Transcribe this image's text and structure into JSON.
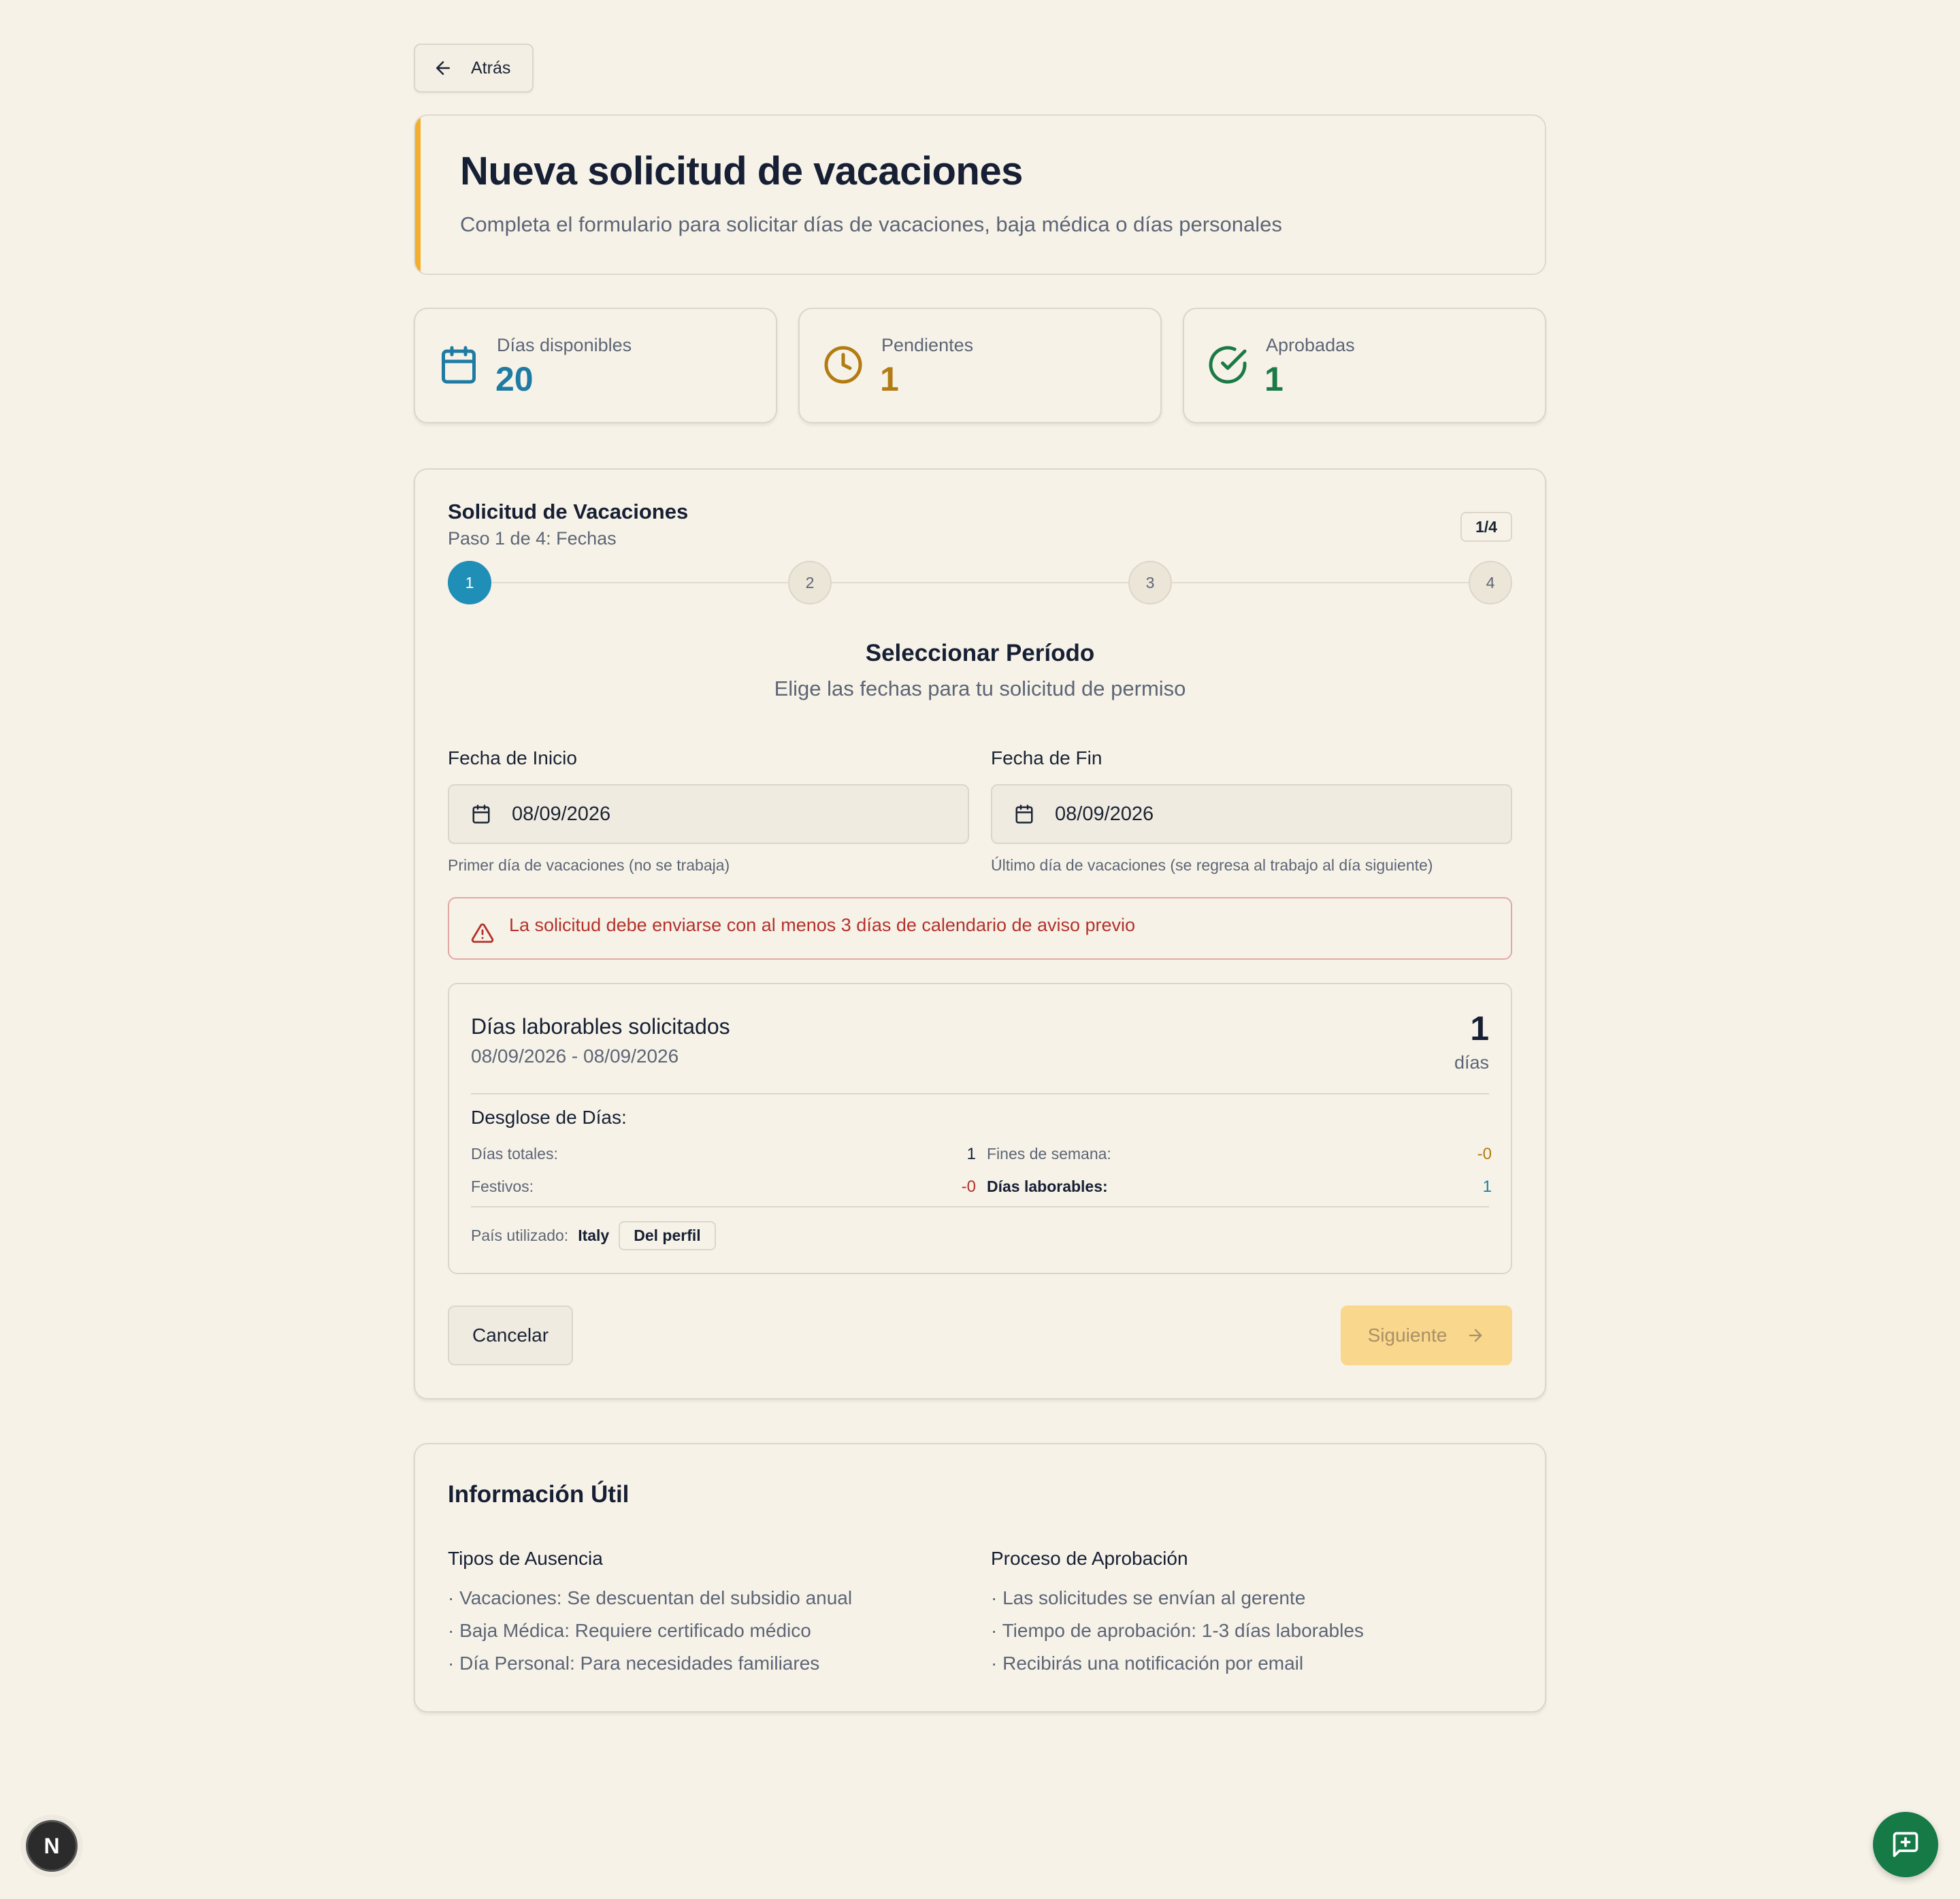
{
  "back": {
    "label": "Atrás"
  },
  "header": {
    "title": "Nueva solicitud de vacaciones",
    "subtitle": "Completa el formulario para solicitar días de vacaciones, baja médica o días personales"
  },
  "stats": [
    {
      "label": "Días disponibles",
      "value": "20",
      "icon": "calendar-icon",
      "color": "#1f7ba3"
    },
    {
      "label": "Pendientes",
      "value": "1",
      "icon": "clock-icon",
      "color": "#b27c12"
    },
    {
      "label": "Aprobadas",
      "value": "1",
      "icon": "check-circle-icon",
      "color": "#1b7a45"
    }
  ],
  "form": {
    "title": "Solicitud de Vacaciones",
    "step_text": "Paso 1 de 4: Fechas",
    "step_badge": "1/4",
    "steps": [
      "1",
      "2",
      "3",
      "4"
    ],
    "active_step": 1,
    "section_title": "Seleccionar Período",
    "section_subtitle": "Elige las fechas para tu solicitud de permiso",
    "start": {
      "label": "Fecha de Inicio",
      "value": "08/09/2026",
      "help": "Primer día de vacaciones (no se trabaja)"
    },
    "end": {
      "label": "Fecha de Fin",
      "value": "08/09/2026",
      "help": "Último día de vacaciones (se regresa al trabajo al día siguiente)"
    },
    "alert": "La solicitud debe enviarse con al menos 3 días de calendario de aviso previo",
    "summary": {
      "title": "Días laborables solicitados",
      "range": "08/09/2026 - 08/09/2026",
      "count": "1",
      "unit": "días",
      "breakdown_title": "Desglose de Días:",
      "total_label": "Días totales:",
      "total_value": "1",
      "weekends_label": "Fines de semana:",
      "weekends_value": "-0",
      "holidays_label": "Festivos:",
      "holidays_value": "-0",
      "workdays_label": "Días laborables:",
      "workdays_value": "1",
      "country_label": "País utilizado:",
      "country_value": "Italy",
      "country_source": "Del perfil"
    },
    "cancel_label": "Cancelar",
    "next_label": "Siguiente"
  },
  "info": {
    "title": "Información Útil",
    "types_title": "Tipos de Ausencia",
    "types": [
      "Vacaciones: Se descuentan del subsidio anual",
      "Baja Médica: Requiere certificado médico",
      "Día Personal: Para necesidades familiares"
    ],
    "process_title": "Proceso de Aprobación",
    "process": [
      "Las solicitudes se envían al gerente",
      "Tiempo de aprobación: 1-3 días laborables",
      "Recibirás una notificación por email"
    ]
  },
  "floating": {
    "logo_letter": "N"
  }
}
